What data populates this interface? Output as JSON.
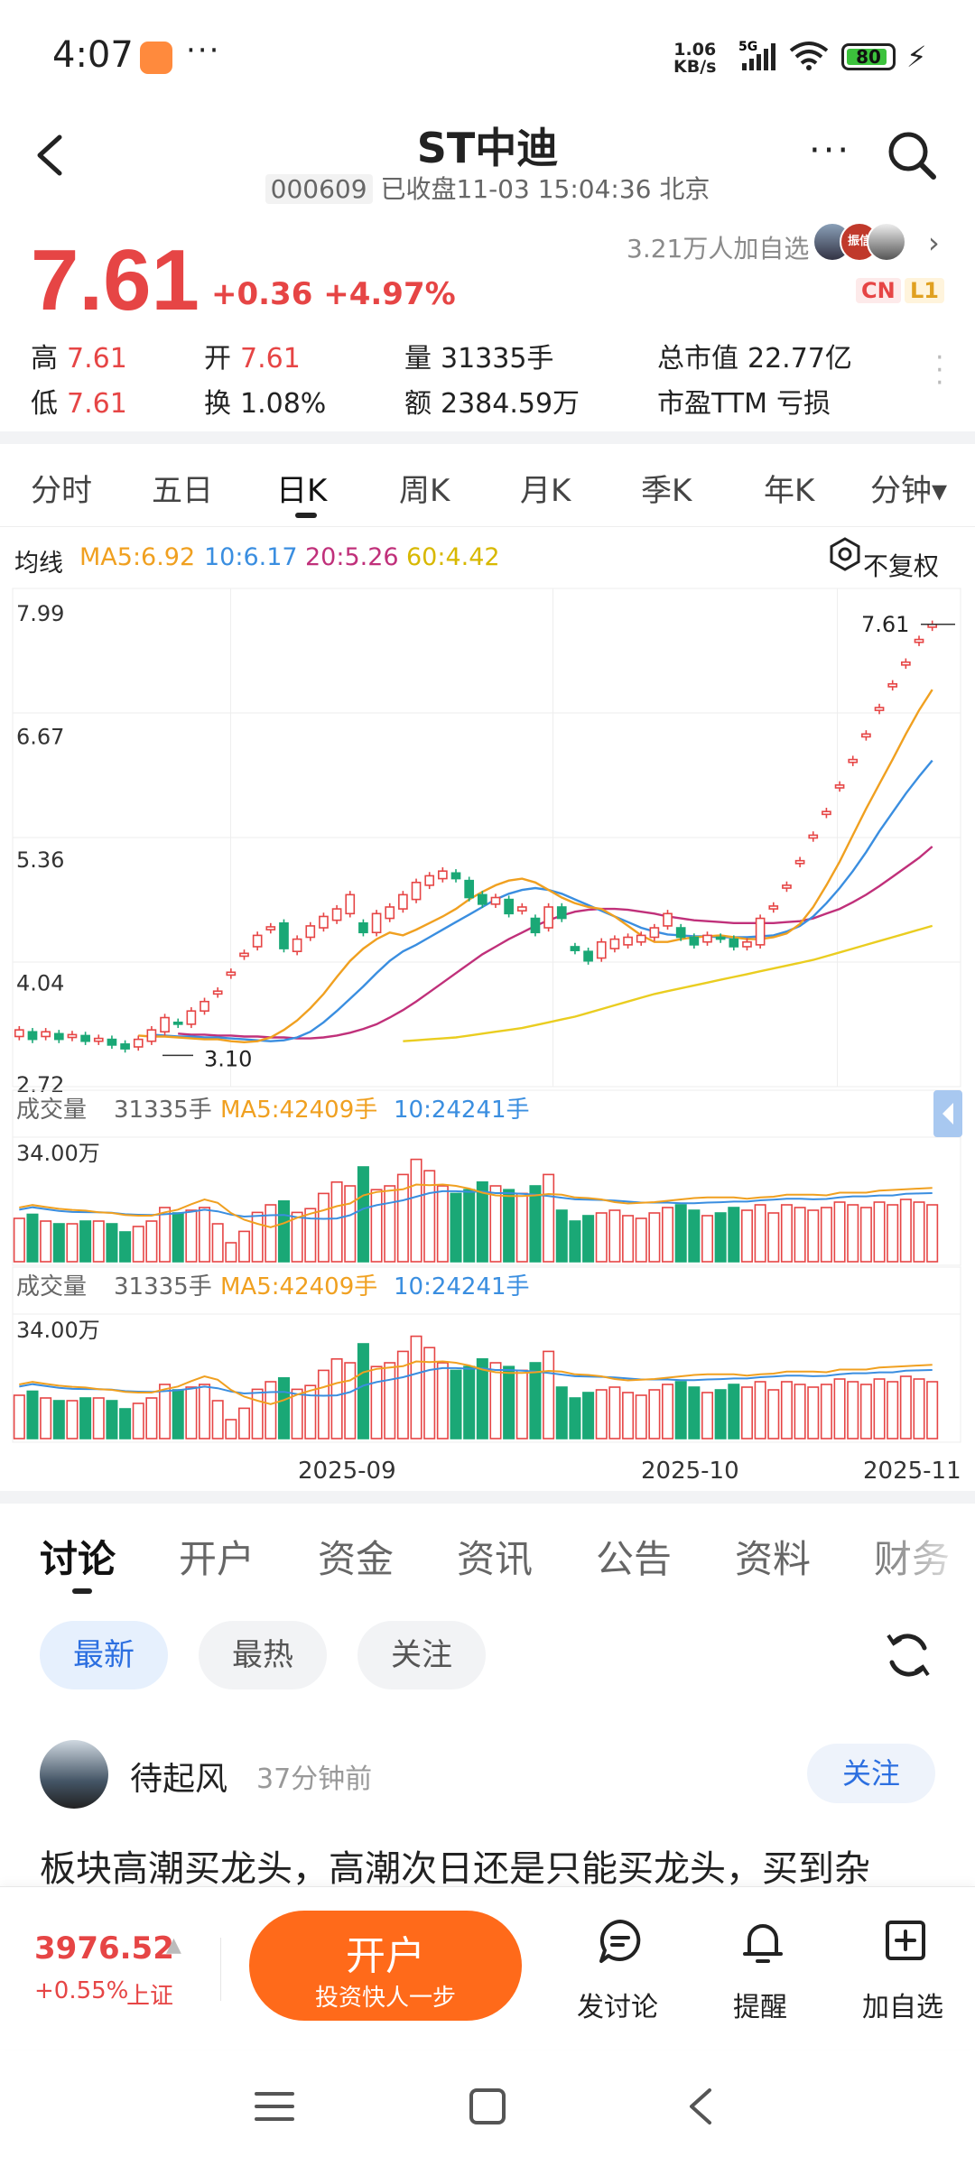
{
  "status_bar": {
    "time": "4:07",
    "net_speed_value": "1.06",
    "net_speed_unit": "KB/s",
    "network": "5G",
    "battery": "80"
  },
  "header": {
    "title": "ST中迪",
    "code": "000609",
    "status": "已收盘11-03 15:04:36 北京"
  },
  "quote": {
    "price": "7.61",
    "change": "+0.36",
    "change_pct": "+4.97%",
    "watchers": "3.21万人加自选",
    "avatar_badge": "振信",
    "badge_cn": "CN",
    "badge_l1": "L1",
    "stats": [
      {
        "label": "高",
        "value": "7.61"
      },
      {
        "label": "开",
        "value": "7.61"
      },
      {
        "label": "量",
        "value": "31335手"
      },
      {
        "label": "总市值",
        "value": "22.77亿"
      },
      {
        "label": "低",
        "value": "7.61"
      },
      {
        "label": "换",
        "value": "1.08%"
      },
      {
        "label": "额",
        "value": "2384.59万"
      },
      {
        "label": "市盈TTM",
        "value": "亏损"
      }
    ]
  },
  "period_tabs": [
    "分时",
    "五日",
    "日K",
    "周K",
    "月K",
    "季K",
    "年K",
    "分钟▾"
  ],
  "active_period": "日K",
  "ma_legend": {
    "label": "均线",
    "ma5": "MA5:6.92",
    "ma10": "10:6.17",
    "ma20": "20:5.26",
    "ma60": "60:4.42",
    "adjust": "不复权"
  },
  "colors": {
    "up": "#e64545",
    "down": "#1aa876",
    "ma5": "#f0a020",
    "ma10": "#3a8ee0",
    "ma20": "#c0307a",
    "ma60": "#eacd20",
    "accent": "#ff6a1a",
    "link": "#2c6fe0"
  },
  "chart_data": {
    "type": "candlestick",
    "y_ticks": [
      "7.99",
      "6.67",
      "5.36",
      "4.04",
      "2.72"
    ],
    "ylim": [
      2.72,
      7.99
    ],
    "high_annotation": "7.61",
    "low_annotation": "3.10",
    "x_labels": [
      "2025-09",
      "2025-10",
      "2025-11"
    ],
    "candles": [
      {
        "o": 3.25,
        "c": 3.32
      },
      {
        "o": 3.3,
        "c": 3.22
      },
      {
        "o": 3.25,
        "c": 3.3
      },
      {
        "o": 3.28,
        "c": 3.22
      },
      {
        "o": 3.24,
        "c": 3.27
      },
      {
        "o": 3.26,
        "c": 3.2
      },
      {
        "o": 3.2,
        "c": 3.23
      },
      {
        "o": 3.22,
        "c": 3.16
      },
      {
        "o": 3.17,
        "c": 3.12
      },
      {
        "o": 3.14,
        "c": 3.22
      },
      {
        "o": 3.2,
        "c": 3.32
      },
      {
        "o": 3.3,
        "c": 3.45
      },
      {
        "o": 3.4,
        "c": 3.38
      },
      {
        "o": 3.38,
        "c": 3.52
      },
      {
        "o": 3.52,
        "c": 3.62
      },
      {
        "o": 3.7,
        "c": 3.73
      },
      {
        "o": 3.9,
        "c": 3.93
      },
      {
        "o": 4.1,
        "c": 4.13
      },
      {
        "o": 4.2,
        "c": 4.32
      },
      {
        "o": 4.38,
        "c": 4.41
      },
      {
        "o": 4.45,
        "c": 4.18
      },
      {
        "o": 4.15,
        "c": 4.28
      },
      {
        "o": 4.3,
        "c": 4.42
      },
      {
        "o": 4.4,
        "c": 4.52
      },
      {
        "o": 4.48,
        "c": 4.6
      },
      {
        "o": 4.55,
        "c": 4.75
      },
      {
        "o": 4.45,
        "c": 4.35
      },
      {
        "o": 4.35,
        "c": 4.55
      },
      {
        "o": 4.5,
        "c": 4.62
      },
      {
        "o": 4.6,
        "c": 4.75
      },
      {
        "o": 4.7,
        "c": 4.88
      },
      {
        "o": 4.85,
        "c": 4.95
      },
      {
        "o": 4.92,
        "c": 5.0
      },
      {
        "o": 4.98,
        "c": 4.92
      },
      {
        "o": 4.9,
        "c": 4.72
      },
      {
        "o": 4.75,
        "c": 4.65
      },
      {
        "o": 4.65,
        "c": 4.72
      },
      {
        "o": 4.7,
        "c": 4.55
      },
      {
        "o": 4.58,
        "c": 4.62
      },
      {
        "o": 4.5,
        "c": 4.35
      },
      {
        "o": 4.4,
        "c": 4.62
      },
      {
        "o": 4.62,
        "c": 4.5
      },
      {
        "o": 4.2,
        "c": 4.16
      },
      {
        "o": 4.15,
        "c": 4.05
      },
      {
        "o": 4.08,
        "c": 4.25
      },
      {
        "o": 4.18,
        "c": 4.28
      },
      {
        "o": 4.22,
        "c": 4.3
      },
      {
        "o": 4.25,
        "c": 4.32
      },
      {
        "o": 4.3,
        "c": 4.4
      },
      {
        "o": 4.42,
        "c": 4.55
      },
      {
        "o": 4.4,
        "c": 4.3
      },
      {
        "o": 4.3,
        "c": 4.22
      },
      {
        "o": 4.25,
        "c": 4.32
      },
      {
        "o": 4.3,
        "c": 4.28
      },
      {
        "o": 4.28,
        "c": 4.2
      },
      {
        "o": 4.2,
        "c": 4.25
      },
      {
        "o": 4.22,
        "c": 4.5
      },
      {
        "o": 4.6,
        "c": 4.63
      },
      {
        "o": 4.82,
        "c": 4.85
      },
      {
        "o": 5.08,
        "c": 5.11
      },
      {
        "o": 5.35,
        "c": 5.38
      },
      {
        "o": 5.6,
        "c": 5.63
      },
      {
        "o": 5.88,
        "c": 5.91
      },
      {
        "o": 6.15,
        "c": 6.18
      },
      {
        "o": 6.42,
        "c": 6.45
      },
      {
        "o": 6.7,
        "c": 6.73
      },
      {
        "o": 6.95,
        "c": 6.98
      },
      {
        "o": 7.18,
        "c": 7.21
      },
      {
        "o": 7.42,
        "c": 7.45
      },
      {
        "o": 7.58,
        "c": 7.61
      }
    ],
    "ma5": [
      3.26,
      3.25,
      3.25,
      3.24,
      3.23,
      3.22,
      3.22,
      3.2,
      3.19,
      3.2,
      3.24,
      3.32,
      3.42,
      3.55,
      3.7,
      3.88,
      4.05,
      4.18,
      4.28,
      4.35,
      4.32,
      4.38,
      4.45,
      4.52,
      4.6,
      4.7,
      4.78,
      4.85,
      4.9,
      4.92,
      4.88,
      4.8,
      4.72,
      4.66,
      4.62,
      4.6,
      4.52,
      4.42,
      4.32,
      4.25,
      4.25,
      4.28,
      4.3,
      4.31,
      4.32,
      4.3,
      4.28,
      4.28,
      4.3,
      4.34,
      4.44,
      4.62,
      4.85,
      5.1,
      5.38,
      5.66,
      5.92,
      6.18,
      6.45,
      6.7,
      6.92
    ],
    "ma10": [
      3.27,
      3.26,
      3.25,
      3.25,
      3.24,
      3.24,
      3.23,
      3.22,
      3.21,
      3.2,
      3.21,
      3.24,
      3.3,
      3.4,
      3.52,
      3.65,
      3.78,
      3.92,
      4.05,
      4.15,
      4.22,
      4.3,
      4.38,
      4.46,
      4.54,
      4.62,
      4.7,
      4.76,
      4.8,
      4.82,
      4.8,
      4.76,
      4.7,
      4.64,
      4.58,
      4.52,
      4.46,
      4.4,
      4.36,
      4.33,
      4.32,
      4.31,
      4.31,
      4.3,
      4.3,
      4.3,
      4.31,
      4.32,
      4.36,
      4.42,
      4.52,
      4.66,
      4.82,
      5.0,
      5.2,
      5.42,
      5.62,
      5.82,
      6.0,
      6.17
    ],
    "ma20": [
      3.28,
      3.27,
      3.27,
      3.26,
      3.26,
      3.25,
      3.25,
      3.24,
      3.24,
      3.23,
      3.23,
      3.24,
      3.26,
      3.29,
      3.33,
      3.38,
      3.45,
      3.53,
      3.62,
      3.72,
      3.82,
      3.92,
      4.02,
      4.12,
      4.2,
      4.28,
      4.35,
      4.42,
      4.48,
      4.53,
      4.57,
      4.59,
      4.6,
      4.6,
      4.59,
      4.57,
      4.55,
      4.52,
      4.5,
      4.48,
      4.47,
      4.46,
      4.45,
      4.45,
      4.45,
      4.45,
      4.46,
      4.47,
      4.5,
      4.55,
      4.6,
      4.67,
      4.75,
      4.84,
      4.94,
      5.04,
      5.14,
      5.26
    ],
    "ma60": [
      3.2,
      3.21,
      3.22,
      3.23,
      3.24,
      3.26,
      3.28,
      3.3,
      3.32,
      3.34,
      3.37,
      3.4,
      3.43,
      3.46,
      3.5,
      3.54,
      3.58,
      3.62,
      3.66,
      3.7,
      3.73,
      3.76,
      3.79,
      3.82,
      3.85,
      3.88,
      3.91,
      3.94,
      3.97,
      4.0,
      4.03,
      4.06,
      4.1,
      4.14,
      4.18,
      4.22,
      4.26,
      4.3,
      4.34,
      4.38,
      4.42
    ],
    "volume_panel": {
      "label": "成交量",
      "volume": "31335手",
      "ma5": "MA5:42409手",
      "ma10": "10:24241手",
      "ymax": "34.00万"
    },
    "volumes": [
      0.32,
      0.35,
      0.3,
      0.28,
      0.28,
      0.3,
      0.3,
      0.28,
      0.22,
      0.26,
      0.3,
      0.4,
      0.36,
      0.38,
      0.4,
      0.2,
      0.1,
      0.16,
      0.26,
      0.3,
      0.32,
      0.26,
      0.28,
      0.36,
      0.42,
      0.4,
      0.5,
      0.38,
      0.4,
      0.46,
      0.54,
      0.48,
      0.4,
      0.36,
      0.38,
      0.42,
      0.4,
      0.38,
      0.36,
      0.4,
      0.46,
      0.38,
      0.3,
      0.34,
      0.36,
      0.38,
      0.34,
      0.32,
      0.36,
      0.4,
      0.42,
      0.38,
      0.34,
      0.36,
      0.4,
      0.38,
      0.42,
      0.36,
      0.42,
      0.4,
      0.38,
      0.4,
      0.44,
      0.42,
      0.4,
      0.44,
      0.42,
      0.46,
      0.44,
      0.42
    ],
    "volume_up": [
      true,
      false,
      true,
      false,
      true,
      false,
      true,
      false,
      false,
      true,
      true,
      true,
      false,
      true,
      true,
      true,
      true,
      true,
      true,
      true,
      false,
      true,
      true,
      true,
      true,
      true,
      false,
      true,
      true,
      true,
      true,
      true,
      true,
      false,
      false,
      false,
      true,
      false,
      true,
      false,
      true,
      false,
      false,
      false,
      true,
      true,
      true,
      true,
      true,
      true,
      false,
      false,
      true,
      false,
      false,
      true,
      true,
      true,
      true,
      true,
      true,
      true,
      true,
      true,
      true,
      true,
      true,
      true,
      true,
      true
    ]
  },
  "discussion_tabs": [
    "讨论",
    "开户",
    "资金",
    "资讯",
    "公告",
    "资料",
    "财务"
  ],
  "filters": [
    "最新",
    "最热",
    "关注"
  ],
  "post": {
    "author": "待起风",
    "time": "37分钟前",
    "follow": "关注",
    "text": "板块高潮买龙头，高潮次日还是只能买龙头，买到杂"
  },
  "bottom_bar": {
    "index_value": "3976.52",
    "index_change": "+0.55%",
    "index_name": "上证",
    "open_account": "开户",
    "open_sub": "投资快人一步",
    "actions": [
      "发讨论",
      "提醒",
      "加自选"
    ]
  }
}
